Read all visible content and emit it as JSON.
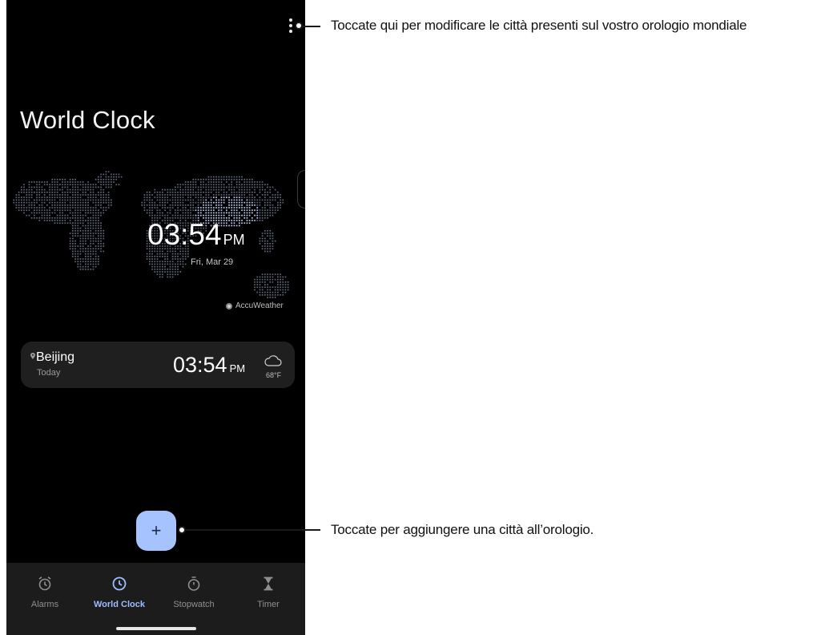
{
  "app": {
    "title": "World Clock",
    "accent_color": "#a6c2ff",
    "background_color": "#000000"
  },
  "header": {
    "menu_icon": "more-vert-icon"
  },
  "map": {
    "time": "03:54",
    "ampm": "PM",
    "date": "Fri, Mar 29",
    "provider": "AccuWeather"
  },
  "cities": [
    {
      "name": "Beijing",
      "day": "Today",
      "time": "03:54",
      "ampm": "PM",
      "weather_icon": "cloud-icon",
      "temperature": "68°F"
    }
  ],
  "fab": {
    "label": "+",
    "icon": "add-icon"
  },
  "bottom_nav": {
    "items": [
      {
        "label": "Alarms",
        "icon": "alarm-icon",
        "active": false
      },
      {
        "label": "World Clock",
        "icon": "clock-icon",
        "active": true
      },
      {
        "label": "Stopwatch",
        "icon": "stopwatch-icon",
        "active": false
      },
      {
        "label": "Timer",
        "icon": "hourglass-icon",
        "active": false
      }
    ]
  },
  "annotations": {
    "menu_callout": "Toccate qui per modificare le città presenti sul vostro orologio mondiale",
    "add_callout": "Toccate per aggiungere una città all’orologio."
  }
}
